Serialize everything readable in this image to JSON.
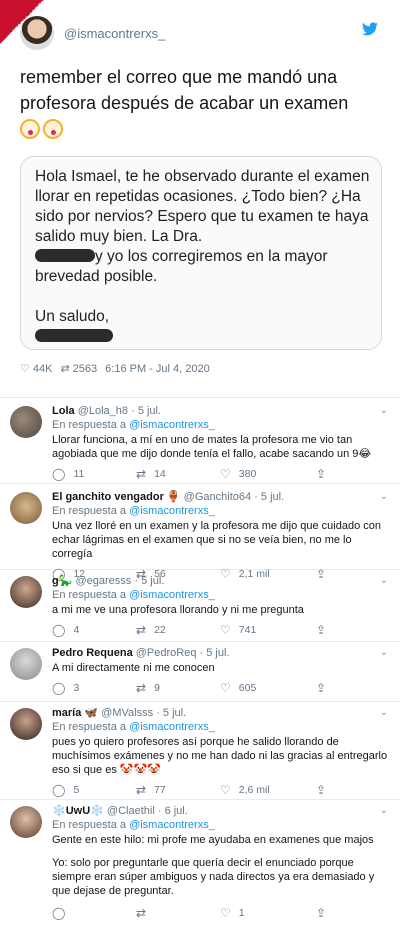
{
  "main": {
    "handle": "@ismacontrerxs_",
    "text": "remember el correo que me mandó una profesora después de acabar un examen",
    "mail_p1a": "Hola Ismael, te he observado durante el examen llorar en repetidas ocasiones. ¿Todo bien? ¿Ha sido por nervios? Espero que tu examen te haya salido muy bien. La Dra.",
    "mail_p1b": "y yo los corregiremos en la mayor brevedad posible.",
    "mail_p2": "Un saludo,",
    "likes": "44K",
    "retweets": "2563",
    "time": "6:16 PM - Jul 4, 2020"
  },
  "common": {
    "replying": "En respuesta a",
    "to": "@ismacontrerxs_"
  },
  "replies": [
    {
      "name": "Lola",
      "handle": "@Lola_h8",
      "date": "5 jul.",
      "text": "Llorar funciona, a mí en uno de mates la profesora me vio tan agobiada que me dijo donde tenía el fallo, acabe sacando un 9😂",
      "c": "11",
      "rt": "14",
      "l": "380"
    },
    {
      "name": "El ganchito vengador 🏺",
      "handle": "@Ganchito64",
      "date": "5 jul.",
      "text": "Una vez lloré en un examen y la profesora me dijo que cuidado con echar lágrimas en el examen que si no se veía bien, no me lo corregía",
      "c": "12",
      "rt": "56",
      "l": "2,1 mil"
    },
    {
      "name": "g🦕",
      "handle": "@egaresss",
      "date": "5 jul.",
      "text": "a mi me ve una profesora llorando y ni me pregunta",
      "c": "4",
      "rt": "22",
      "l": "741"
    },
    {
      "name": "Pedro Requena",
      "handle": "@PedroReq",
      "date": "5 jul.",
      "text": "A mi directamente ni me conocen",
      "c": "3",
      "rt": "9",
      "l": "605"
    },
    {
      "name": "maría 🦋",
      "handle": "@MValsss",
      "date": "5 jul.",
      "text": "pues yo quiero profesores así porque he salido llorando de muchísimos exámenes y no me han dado ni las gracias al entregarlo eso si que es 🤡🤡🤡",
      "c": "5",
      "rt": "77",
      "l": "2,6 mil"
    },
    {
      "name": "❄️UwU❄️",
      "handle": "@Claethil",
      "date": "6 jul.",
      "text": "Gente en este hilo: mi profe me ayudaba en examenes que majos",
      "text2": "Yo: solo por preguntarle que quería decir el enunciado porque siempre eran súper ambiguos y nada directos ya era demasiado y que dejase de preguntar.",
      "c": "",
      "rt": "",
      "l": "1"
    }
  ]
}
